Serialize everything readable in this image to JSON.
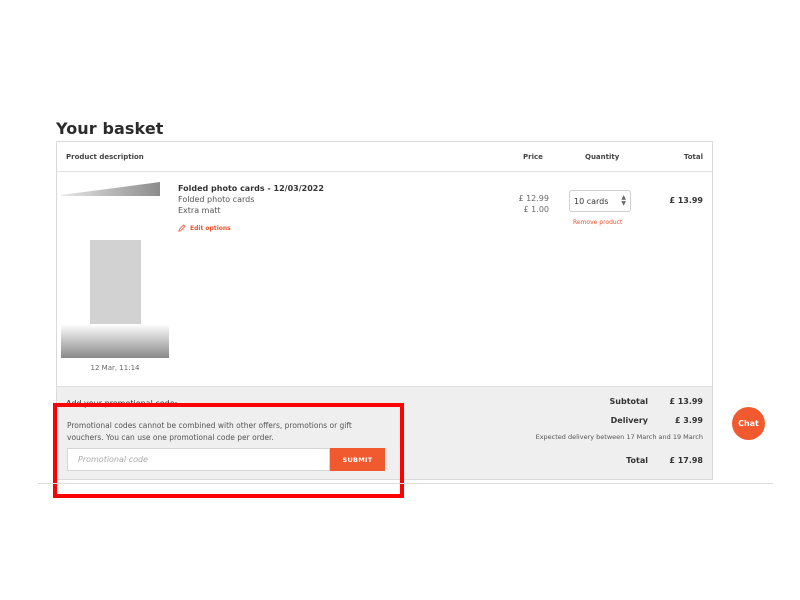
{
  "page": {
    "title": "Your basket"
  },
  "table_header": {
    "product_description": "Product description",
    "price": "Price",
    "quantity": "Quantity",
    "total": "Total"
  },
  "product": {
    "title": "Folded photo cards - 12/03/2022",
    "type": "Folded photo cards",
    "finish": "Extra matt",
    "edit_label": "Edit options",
    "thumbnail_date": "12 Mar, 11:14",
    "prices": [
      "£ 12.99",
      "£ 1.00"
    ],
    "quantity_selected": "10 cards",
    "remove_label": "Remove product",
    "total": "£ 13.99"
  },
  "promo": {
    "heading": "Add your promotional code:",
    "note": "Promotional codes cannot be combined with other offers, promotions or gift vouchers. You can use one promotional code per order.",
    "placeholder": "Promotional code",
    "submit_label": "SUBMIT"
  },
  "summary": {
    "subtotal_label": "Subtotal",
    "subtotal_value": "£ 13.99",
    "delivery_label": "Delivery",
    "delivery_value": "£ 3.99",
    "delivery_note": "Expected delivery between 17 March and 19 March",
    "total_label": "Total",
    "total_value": "£ 17.98"
  },
  "chat": {
    "label": "Chat"
  },
  "colors": {
    "accent": "#f05a2e",
    "highlight": "#ff0000",
    "summary_bg": "#efefef"
  }
}
